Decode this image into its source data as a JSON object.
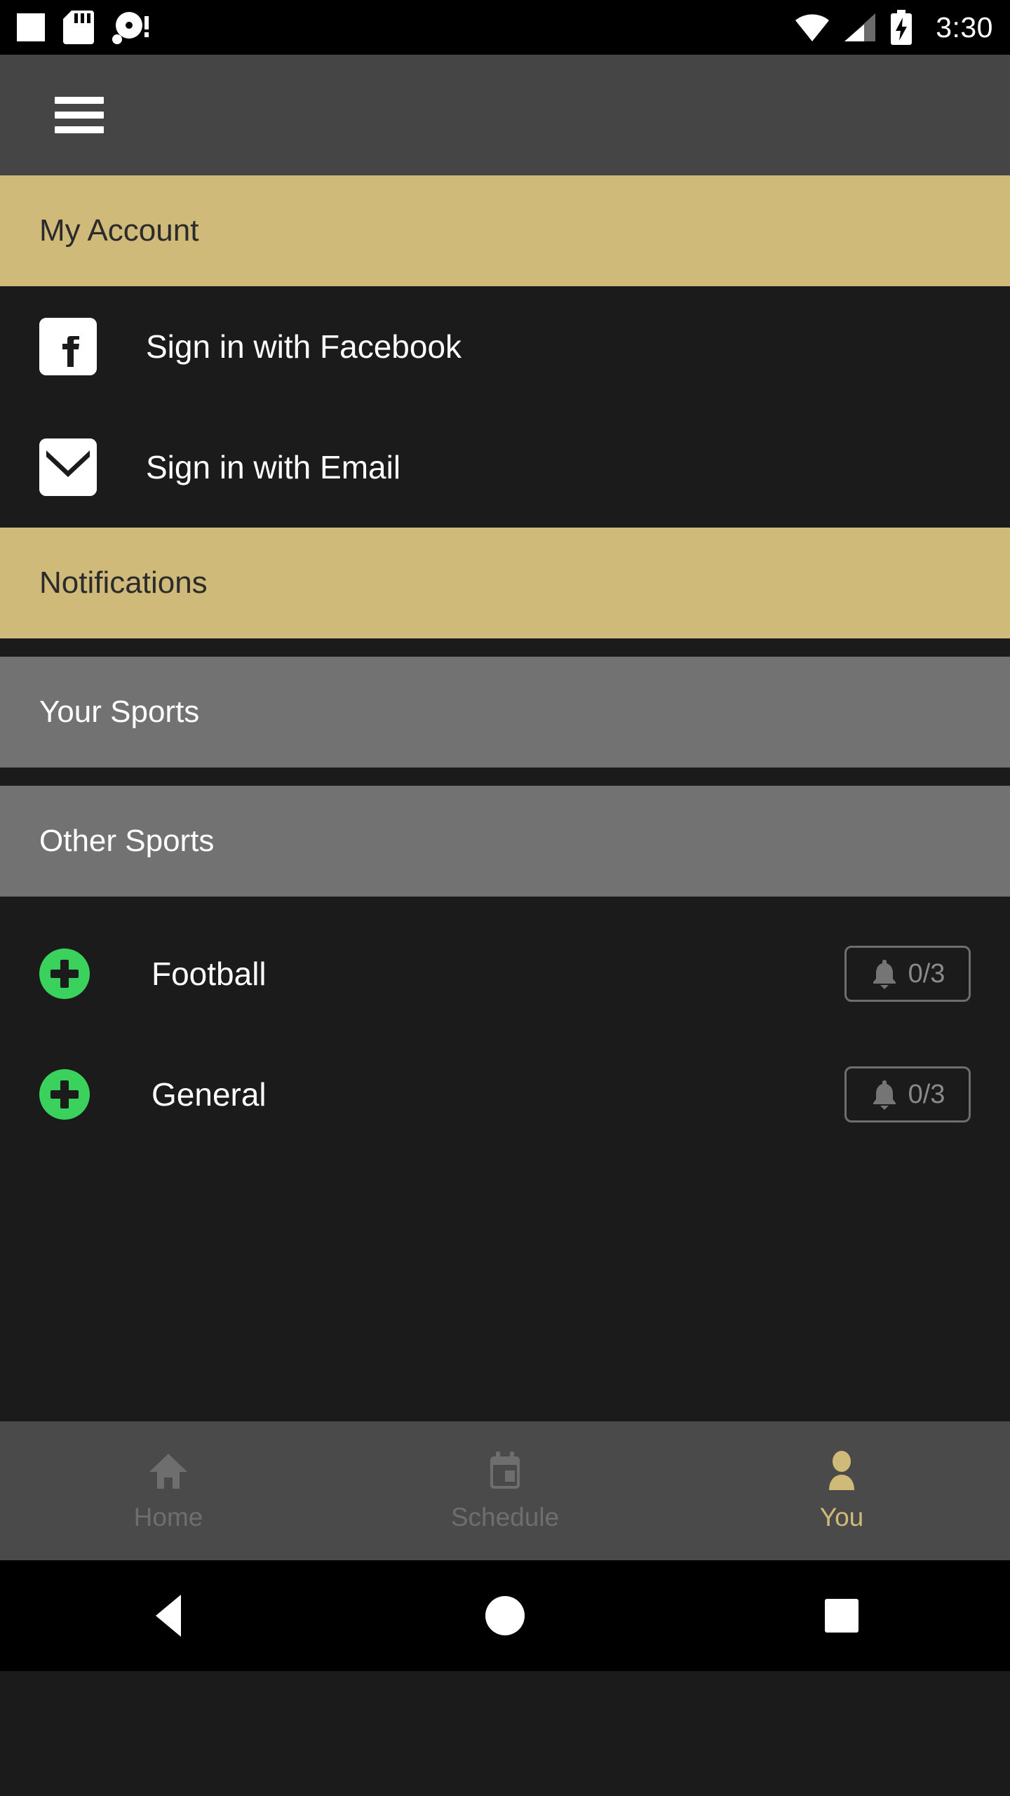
{
  "status_bar": {
    "time": "3:30",
    "left_icons": [
      "screenshot-icon",
      "sd-card-icon",
      "disc-alert-icon"
    ],
    "right_icons": [
      "wifi-icon",
      "cell-signal-icon",
      "battery-charging-icon"
    ]
  },
  "app_bar": {
    "menu_icon": "hamburger-menu-icon"
  },
  "sections": {
    "my_account": {
      "title": "My Account",
      "items": [
        {
          "icon": "facebook-icon",
          "label": "Sign in with Facebook"
        },
        {
          "icon": "email-icon",
          "label": "Sign in with Email"
        }
      ]
    },
    "notifications": {
      "title": "Notifications",
      "your_sports": {
        "title": "Your Sports",
        "items": []
      },
      "other_sports": {
        "title": "Other Sports",
        "items": [
          {
            "add_icon": "plus-circle-icon",
            "label": "Football",
            "bell_icon": "bell-icon",
            "count": "0/3"
          },
          {
            "add_icon": "plus-circle-icon",
            "label": "General",
            "bell_icon": "bell-icon",
            "count": "0/3"
          }
        ]
      }
    }
  },
  "bottom_nav": {
    "items": [
      {
        "icon": "home-icon",
        "label": "Home",
        "active": false
      },
      {
        "icon": "calendar-icon",
        "label": "Schedule",
        "active": false
      },
      {
        "icon": "person-icon",
        "label": "You",
        "active": true
      }
    ]
  },
  "system_nav": {
    "back": "back-triangle-icon",
    "home": "home-circle-icon",
    "recents": "recents-square-icon"
  },
  "colors": {
    "accent_tan": "#d0ba79",
    "section_gray": "#727272",
    "app_bar_gray": "#454545",
    "background_dark": "#1b1b1b",
    "add_green": "#3ad15c",
    "muted_gray": "#6e6e6e"
  }
}
